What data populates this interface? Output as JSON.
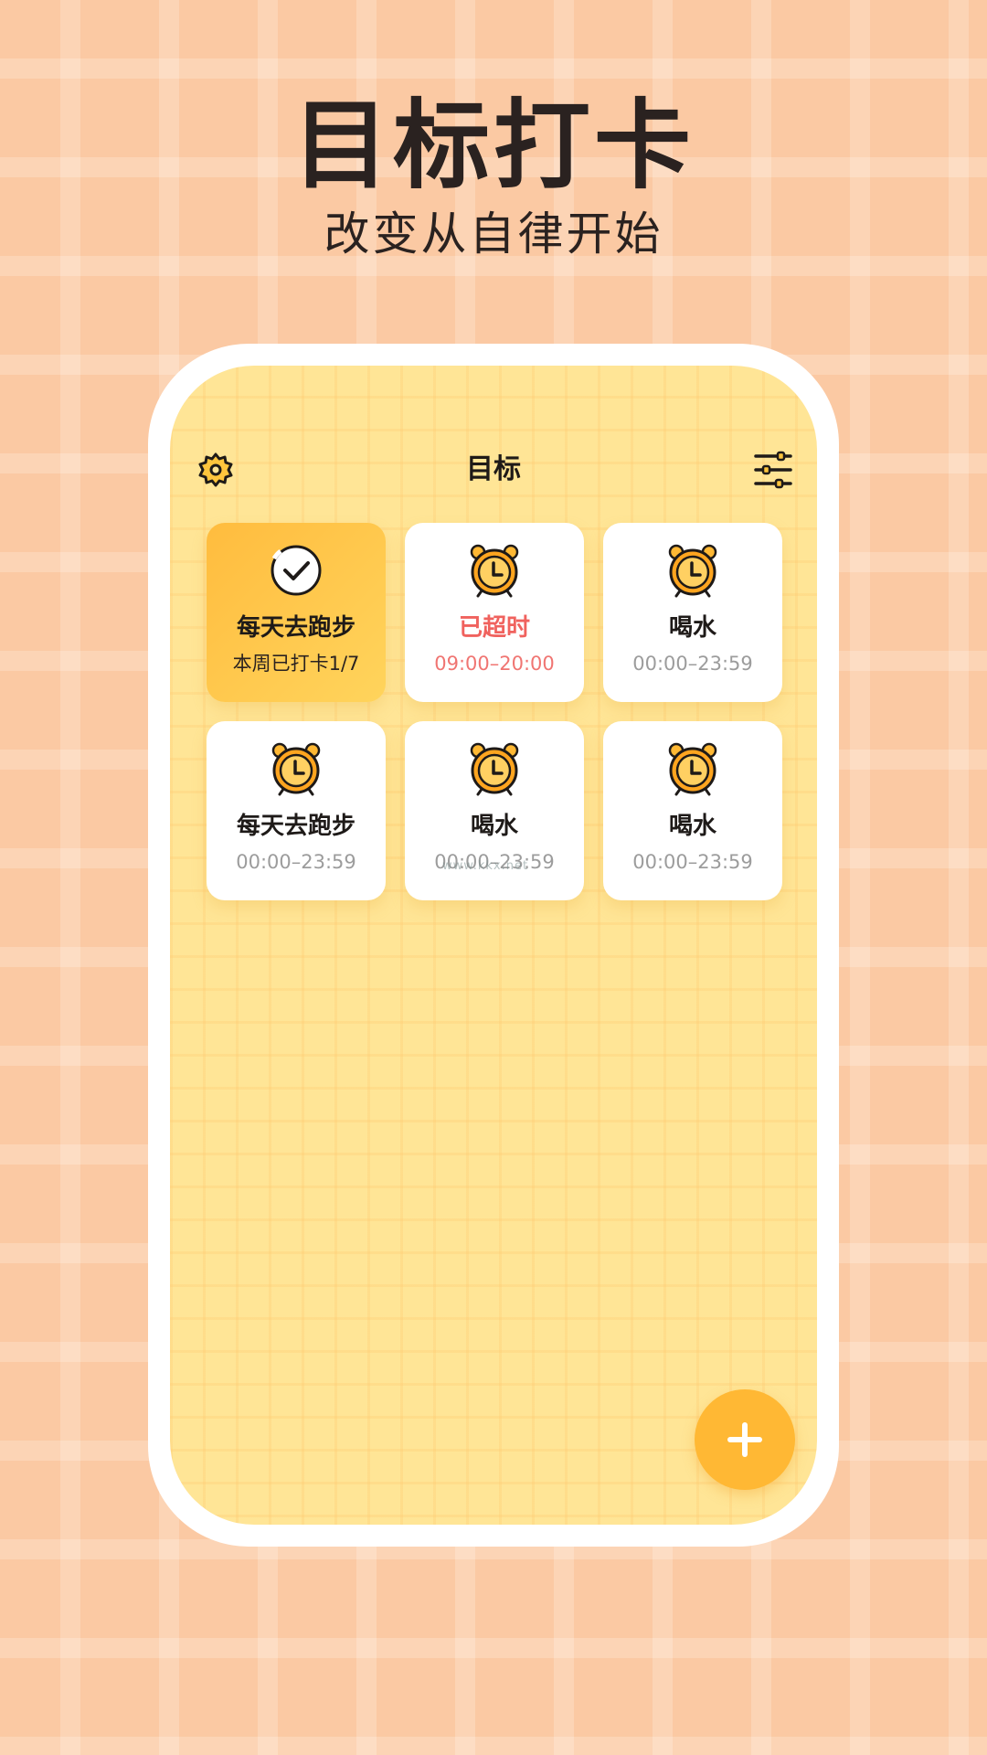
{
  "hero": {
    "title": "目标打卡",
    "subtitle": "改变从自律开始"
  },
  "header": {
    "title": "目标",
    "settings_icon": "gear-icon",
    "filter_icon": "sliders-icon"
  },
  "goals": [
    {
      "name": "每天去跑步",
      "detail": "本周已打卡1/7",
      "status": "done",
      "icon": "check-circle-icon"
    },
    {
      "name": "已超时",
      "detail": "09:00–20:00",
      "status": "overdue",
      "icon": "alarm-clock-icon"
    },
    {
      "name": "喝水",
      "detail": "00:00–23:59",
      "status": "pending",
      "icon": "alarm-clock-icon"
    },
    {
      "name": "每天去跑步",
      "detail": "00:00–23:59",
      "status": "pending",
      "icon": "alarm-clock-icon"
    },
    {
      "name": "喝水",
      "detail": "00:00–23:59",
      "status": "pending",
      "icon": "alarm-clock-icon"
    },
    {
      "name": "喝水",
      "detail": "00:00–23:59",
      "status": "pending",
      "icon": "alarm-clock-icon"
    }
  ],
  "add_button": {
    "icon": "plus-icon"
  },
  "watermark": "www.kkx.net",
  "colors": {
    "background": "#FBC9A3",
    "screen": "#FFE596",
    "accent": "#FFB834",
    "overdue": "#F0625E",
    "muted_text": "#9C9C9C"
  }
}
